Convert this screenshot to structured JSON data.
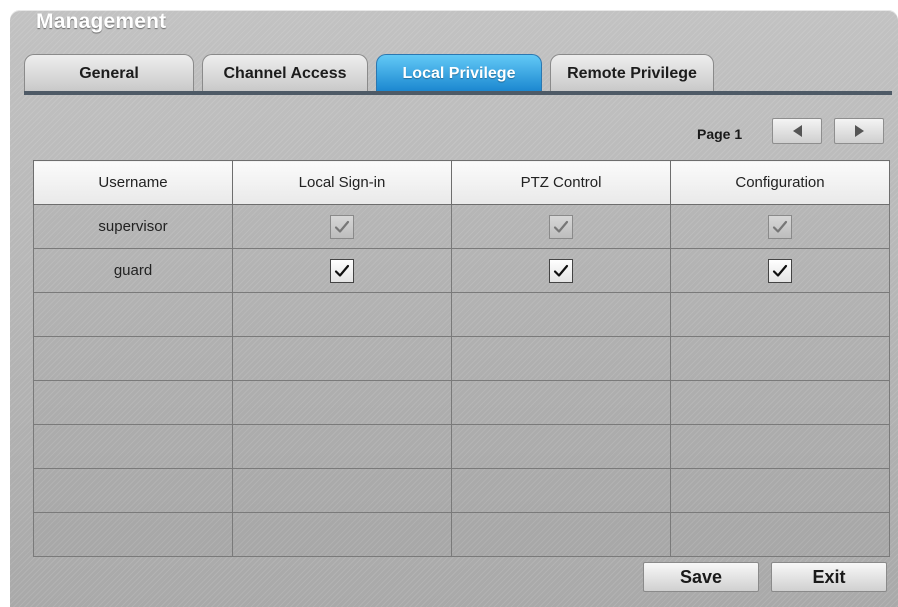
{
  "window": {
    "title": "Management"
  },
  "tabs": [
    {
      "label": "General",
      "active": false
    },
    {
      "label": "Channel Access",
      "active": false
    },
    {
      "label": "Local Privilege",
      "active": true
    },
    {
      "label": "Remote Privilege",
      "active": false
    }
  ],
  "pager": {
    "label": "Page 1",
    "prev_icon": "triangle-left-icon",
    "next_icon": "triangle-right-icon"
  },
  "table": {
    "columns": [
      "Username",
      "Local Sign-in",
      "PTZ Control",
      "Configuration"
    ],
    "rows": [
      {
        "username": "supervisor",
        "local_sign_in": true,
        "ptz_control": true,
        "configuration": true,
        "disabled": true
      },
      {
        "username": "guard",
        "local_sign_in": true,
        "ptz_control": true,
        "configuration": true,
        "disabled": false
      },
      {
        "username": "",
        "empty": true
      },
      {
        "username": "",
        "empty": true
      },
      {
        "username": "",
        "empty": true
      },
      {
        "username": "",
        "empty": true
      },
      {
        "username": "",
        "empty": true
      },
      {
        "username": "",
        "empty": true
      }
    ]
  },
  "actions": {
    "save_label": "Save",
    "exit_label": "Exit"
  },
  "colors": {
    "active_tab": "#1a86cf",
    "panel": "#b5b5b5",
    "tab_underline": "#4e5a66"
  }
}
